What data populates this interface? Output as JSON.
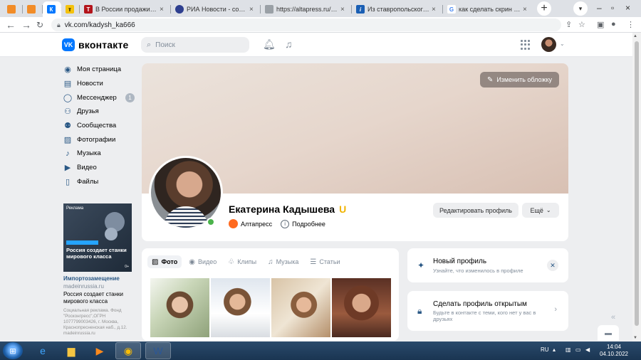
{
  "browser": {
    "tabs": [
      {
        "title": "",
        "favicon": "orange-sail"
      },
      {
        "title": "",
        "favicon": "orange-sail"
      },
      {
        "title": "",
        "favicon": "vk",
        "active": true
      },
      {
        "title": "",
        "favicon": "yellow-t"
      },
      {
        "title": "В России продажи усп",
        "favicon": "red-t"
      },
      {
        "title": "РИА Новости - событи",
        "favicon": "ria"
      },
      {
        "title": "https://altapress.ru/сpa",
        "favicon": "doc"
      },
      {
        "title": "Из ставропольского ба",
        "favicon": "blue-i"
      },
      {
        "title": "как сделать скрин экра",
        "favicon": "google"
      }
    ],
    "url": "vk.com/kadysh_ka666"
  },
  "vk": {
    "logo_text": "вконтакте",
    "search_placeholder": "Поиск",
    "nav": [
      {
        "label": "Моя страница",
        "icon": "user-circle-icon"
      },
      {
        "label": "Новости",
        "icon": "news-icon"
      },
      {
        "label": "Мессенджер",
        "icon": "message-icon",
        "count": "1"
      },
      {
        "label": "Друзья",
        "icon": "friends-icon"
      },
      {
        "label": "Сообщества",
        "icon": "communities-icon"
      },
      {
        "label": "Фотографии",
        "icon": "photo-icon"
      },
      {
        "label": "Музыка",
        "icon": "music-icon"
      },
      {
        "label": "Видео",
        "icon": "video-icon"
      },
      {
        "label": "Файлы",
        "icon": "files-icon"
      }
    ],
    "ad": {
      "image_header": "Реклама",
      "image_headline": "Россия создает станки мирового класса",
      "image_age": "0+",
      "title": "Импортозамещение",
      "site": "madeinrussia.ru",
      "description": "Россия создает станки мирового класса",
      "legal": "Социальная реклама. Фонд \"Росконгресс\",ОГРН 1077799003426, г. Москва, Краснопресненская наб., д.12. madeinrussia.ru"
    },
    "profile": {
      "change_cover": "Изменить обложку",
      "name": "Екатерина Кадышева",
      "verified_badge": "U",
      "organization": "Алтапресс",
      "details": "Подробнее",
      "edit_profile": "Редактировать профиль",
      "more": "Ещё"
    },
    "media_tabs": [
      {
        "label": "Фото",
        "active": true
      },
      {
        "label": "Видео"
      },
      {
        "label": "Клипы"
      },
      {
        "label": "Музыка"
      },
      {
        "label": "Статьи"
      }
    ],
    "widgets": {
      "new_profile": {
        "title": "Новый профиль",
        "subtitle": "Узнайте, что изменилось в профиле"
      },
      "open_profile": {
        "title": "Сделать профиль открытым",
        "subtitle": "Будьте в контакте с теми, кого нет у вас в друзьях"
      }
    }
  },
  "taskbar": {
    "lang": "RU",
    "time": "14:04",
    "date": "04.10.2022"
  }
}
